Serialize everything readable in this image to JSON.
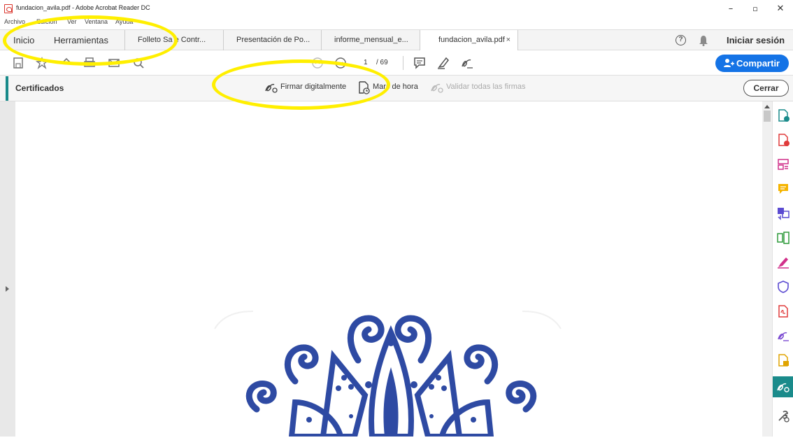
{
  "window": {
    "title": "fundacion_avila.pdf - Adobe Acrobat Reader DC",
    "minimize": "–",
    "maximize": "▫",
    "close": "✕"
  },
  "menu": {
    "items": [
      "Archivo",
      "Edición",
      "Ver",
      "Ventana",
      "Ayuda"
    ]
  },
  "tabs": {
    "nav": [
      "Inicio",
      "Herramientas"
    ],
    "documents": [
      {
        "label": "Folleto Sa e Contr..."
      },
      {
        "label": "Presentación de Po..."
      },
      {
        "label": "informe_mensual_e..."
      },
      {
        "label": "fundacion_avila.pdf",
        "active": true
      }
    ],
    "close_glyph": "×",
    "help": "?",
    "sign_in": "Iniciar sesión"
  },
  "toolbar": {
    "page_current": "1",
    "page_total": "/ 69",
    "share_label": "Compartir"
  },
  "certificates": {
    "title": "Certificados",
    "actions": [
      {
        "label": "Firmar digitalmente",
        "enabled": true
      },
      {
        "label": "Marc  de hora",
        "enabled": true
      },
      {
        "label": "Validar todas las firmas",
        "enabled": false
      }
    ],
    "close_label": "Cerrar"
  },
  "right_panel": {
    "icons": [
      "create-pdf-icon",
      "add-pdf-icon",
      "organize-pages-icon",
      "comment-icon",
      "export-pdf-icon",
      "combine-files-icon",
      "fill-sign-icon",
      "protect-icon",
      "edit-pdf-icon",
      "send-for-signature-icon",
      "request-signature-icon",
      "certificates-icon",
      "more-tools-icon"
    ]
  },
  "colors": {
    "accent_teal": "#1a8b8b",
    "share_blue": "#1473e6",
    "highlight_yellow": "#ffef00",
    "mandala_blue": "#2e4aa3"
  }
}
